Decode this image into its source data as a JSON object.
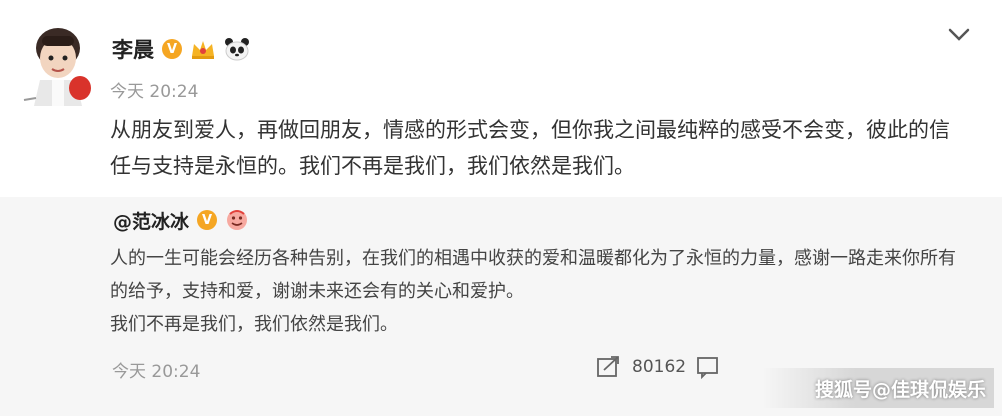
{
  "post": {
    "author": "李晨",
    "verified_badge": "V",
    "badges": [
      "crown-icon",
      "panda-icon"
    ],
    "timestamp": "今天 20:24",
    "text": "从朋友到爱人，再做回朋友，情感的形式会变，但你我之间最纯粹的感受不会变，彼此的信任与支持是永恒的。我们不再是我们，我们依然是我们。"
  },
  "repost": {
    "author": "@范冰冰",
    "verified_badge": "V",
    "badges": [
      "emoji-icon"
    ],
    "lines": [
      "人的一生可能会经历各种告别，在我们的相遇中收获的爱和温暖都化为了永恒的力量，感谢一路走来你所有的给予，支持和爱，谢谢未来还会有的关心和爱护。",
      "我们不再是我们，我们依然是我们。"
    ],
    "timestamp": "今天 20:24",
    "share_count": "80162"
  },
  "watermark": "搜狐号@佳琪侃娱乐",
  "colors": {
    "verified_badge": "#f5a623",
    "repost_background": "#f6f6f6",
    "timestamp": "#999999"
  }
}
